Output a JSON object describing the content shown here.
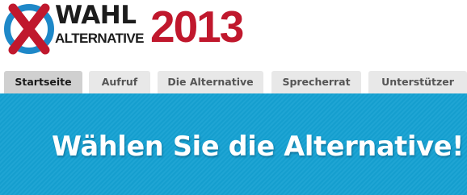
{
  "logo": {
    "line1": "WAHL",
    "line2": "ALTERNATIVE",
    "year": "2013",
    "colors": {
      "mark_blue": "#1e88c8",
      "mark_red": "#c0182d",
      "text_dark": "#1c1c1c",
      "year_red": "#c0182d"
    }
  },
  "nav": {
    "tabs": [
      {
        "label": "Startseite",
        "active": true
      },
      {
        "label": "Aufruf",
        "active": false
      },
      {
        "label": "Die Alternative",
        "active": false
      },
      {
        "label": "Sprecherrat",
        "active": false
      },
      {
        "label": "Unterstützer",
        "active": false
      }
    ]
  },
  "hero": {
    "heading": "Wählen Sie die Alternative!",
    "background_color": "#15a1d2"
  }
}
